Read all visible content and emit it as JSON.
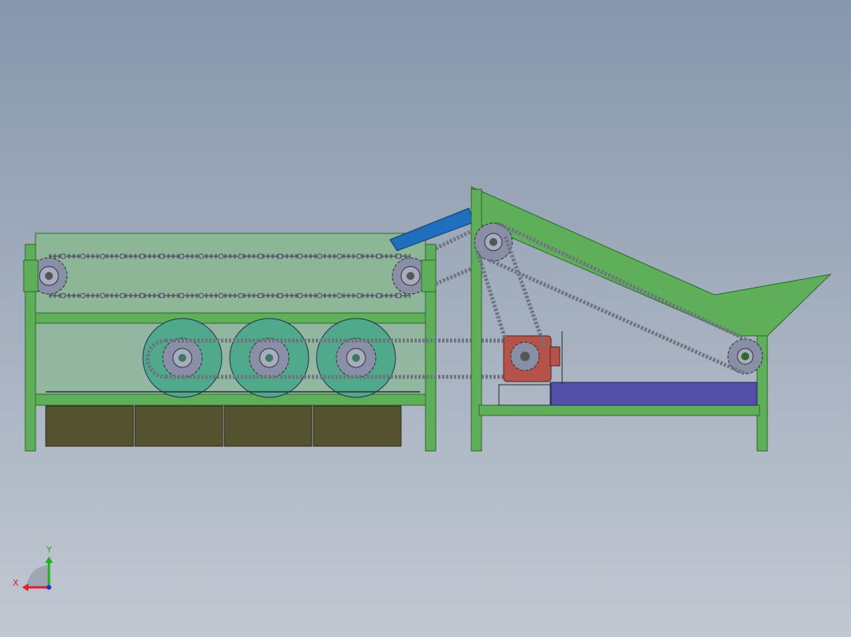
{
  "viewport": {
    "background_top": "#8797ac",
    "background_bottom": "#c2c8d2"
  },
  "colors": {
    "frame_green": "#5fae5a",
    "frame_edge": "#2d6a2a",
    "panel_green": "#86b98a",
    "roller_teal": "#4fa98a",
    "sprocket_gray": "#8a8fa8",
    "chain_gray": "#6e7480",
    "hopper_box": "#55532f",
    "chute_blue": "#1f6fbf",
    "motor_red": "#b5524a",
    "belt_purple": "#5050a8"
  },
  "triad": {
    "x_label": "X",
    "y_label": "Y",
    "x_color": "#e0202a",
    "y_color": "#20b020",
    "z_color": "#2030d0"
  }
}
